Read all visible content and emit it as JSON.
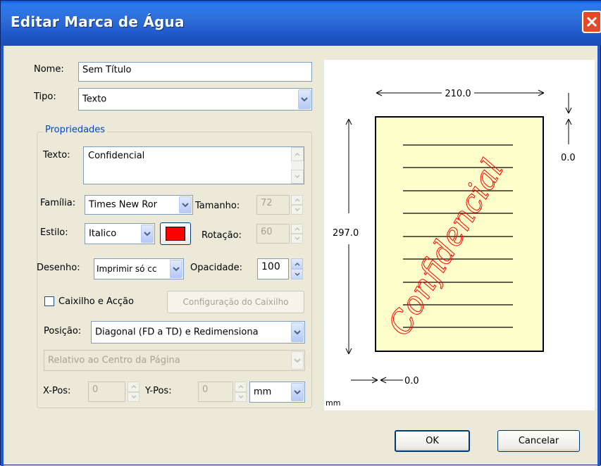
{
  "window": {
    "title": "Editar Marca de Água"
  },
  "icons": {
    "close": "close-icon",
    "dropdown": "chevron-down-icon",
    "spin_up": "arrow-up-icon",
    "spin_down": "arrow-down-icon"
  },
  "colors": {
    "titlebar": "#2f6fd9",
    "group_title": "#0046d5",
    "watermark_color": "#ff0000",
    "page_fill": "#ffffcc"
  },
  "form": {
    "nome_label": "Nome:",
    "nome_value": "Sem Título",
    "tipo_label": "Tipo:",
    "tipo_value": "Texto",
    "group_title": "Propriedades",
    "texto_label": "Texto:",
    "texto_value": "Confidencial",
    "familia_label": "Família:",
    "familia_value": "Times New Ror",
    "tamanho_label": "Tamanho:",
    "tamanho_value": "72",
    "estilo_label": "Estilo:",
    "estilo_value": "Italico",
    "rotacao_label": "Rotação:",
    "rotacao_value": "60",
    "desenho_label": "Desenho:",
    "desenho_value": "Imprimir só cc",
    "opacidade_label": "Opacidade:",
    "opacidade_value": "100",
    "caixilho_label": "Caixilho e Acção",
    "caixilho_checked": false,
    "config_caixilho_label": "Configuração do Caixilho",
    "posicao_label": "Posição:",
    "posicao_value": "Diagonal (FD a TD) e Redimensiona",
    "relativo_value": "Relativo ao Centro da Página",
    "xpos_label": "X-Pos:",
    "xpos_value": "0",
    "ypos_label": "Y-Pos:",
    "ypos_value": "0",
    "unit_value": "mm"
  },
  "preview": {
    "width_label": "210.0",
    "height_label": "297.0",
    "top_offset_label": "0.0",
    "left_offset_label": "0.0",
    "unit_label": "mm",
    "watermark_text": "Confidencial"
  },
  "buttons": {
    "ok": "OK",
    "cancel": "Cancelar"
  }
}
